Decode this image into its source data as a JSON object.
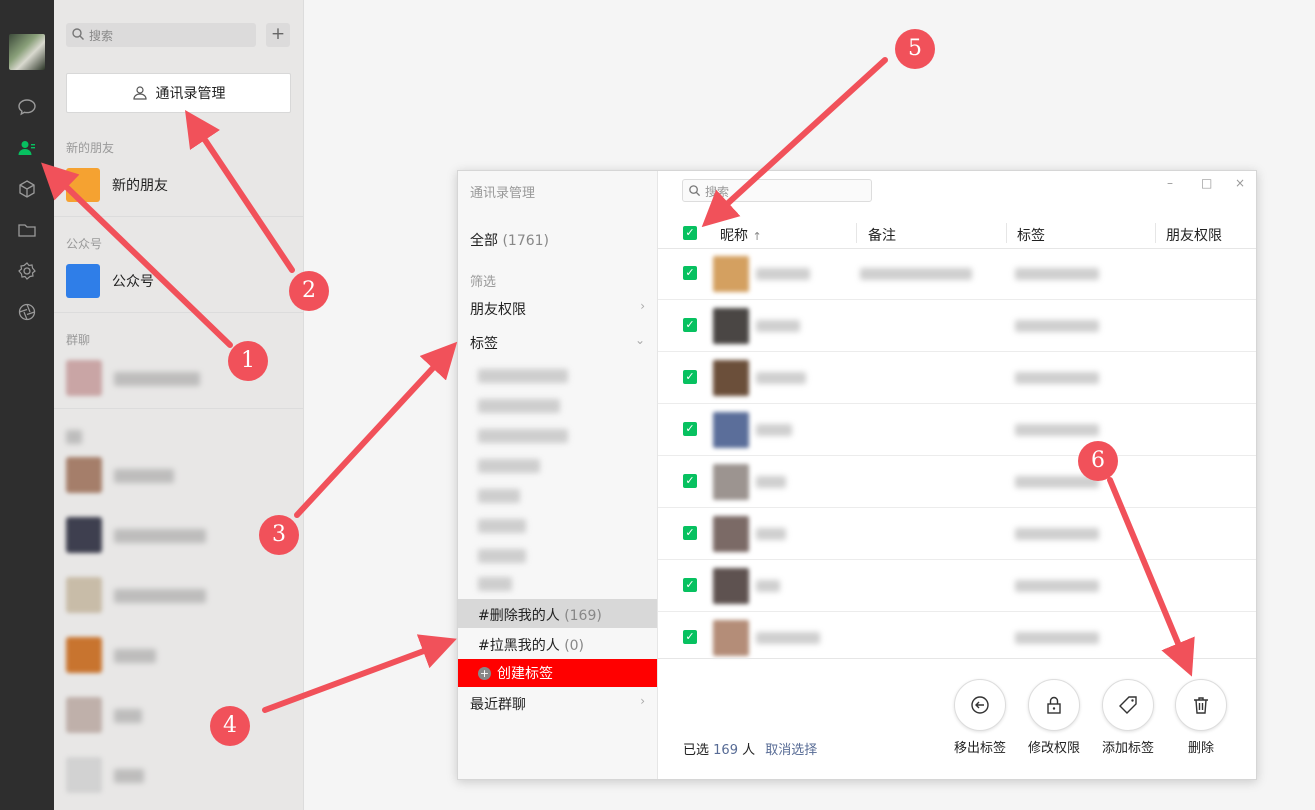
{
  "search": {
    "placeholder": "搜索"
  },
  "contacts_manager_label": "通讯录管理",
  "sections": {
    "new_friends_header": "新的朋友",
    "new_friends_label": "新的朋友",
    "official_header": "公众号",
    "official_label": "公众号",
    "groups_header": "群聊"
  },
  "window": {
    "title": "通讯录管理",
    "all_label": "全部",
    "all_count": "(1761)",
    "filter_label": "筛选",
    "friend_perm": "朋友权限",
    "tags_label": "标签",
    "deleted_me": "#删除我的人",
    "deleted_me_count": "(169)",
    "blocked_me": "#拉黑我的人",
    "blocked_me_count": "(0)",
    "create_tag": "创建标签",
    "recent_groups": "最近群聊",
    "search_placeholder": "搜索",
    "columns": {
      "nickname": "昵称",
      "sort_arrow": "↑",
      "remark": "备注",
      "tag": "标签",
      "permission": "朋友权限"
    },
    "selected_prefix": "已选",
    "selected_count": "169",
    "selected_suffix": "人",
    "cancel_select": "取消选择",
    "actions": {
      "remove_tag": "移出标签",
      "edit_perm": "修改权限",
      "add_tag": "添加标签",
      "delete": "删除"
    }
  },
  "annotations": [
    "1",
    "2",
    "3",
    "4",
    "5",
    "6"
  ],
  "colors": {
    "accent_green": "#07c160",
    "annotation_red": "#f1515a",
    "highlight_red": "#ff0000",
    "link_blue": "#576b95"
  },
  "icons": [
    "chat-icon",
    "contacts-icon",
    "box-icon",
    "folder-icon",
    "gear-icon",
    "aperture-icon",
    "search-icon",
    "plus-icon",
    "person-icon",
    "trash-icon",
    "tag-icon",
    "lock-icon",
    "arrow-left-icon"
  ]
}
